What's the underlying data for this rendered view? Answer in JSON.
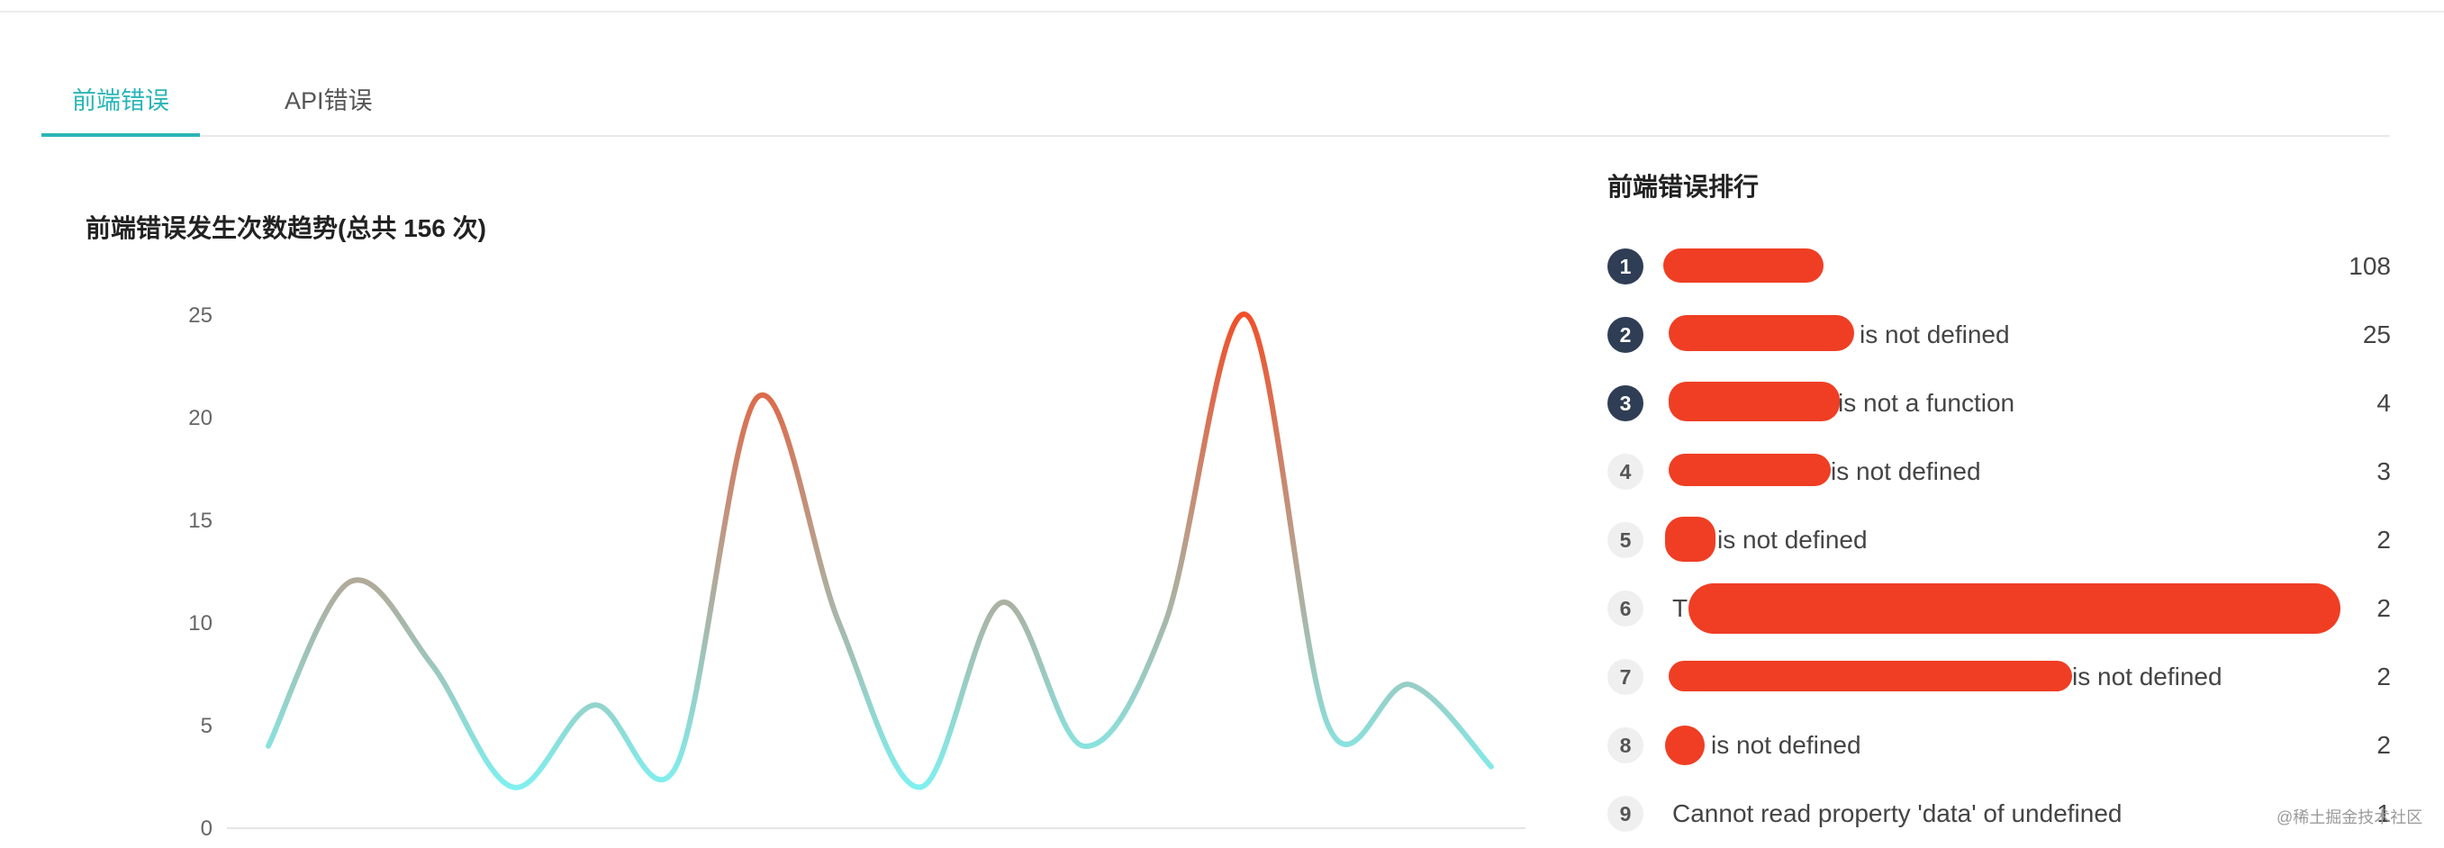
{
  "tabs": [
    {
      "label": "前端错误",
      "active": true
    },
    {
      "label": "API错误",
      "active": false
    }
  ],
  "chart_title": "前端错误发生次数趋势(总共 156 次)",
  "chart_data": {
    "type": "line",
    "title": "前端错误发生次数趋势(总共 156 次)",
    "yticks": [
      0,
      5,
      10,
      15,
      20,
      25
    ],
    "ylim": [
      0,
      25
    ],
    "values": [
      4,
      12,
      8,
      2,
      6,
      3,
      21,
      10,
      2,
      11,
      4,
      10,
      25,
      5,
      7,
      3
    ],
    "smooth": true,
    "gradient_colors": [
      "#7ff0f0",
      "#f0502a"
    ],
    "grid": false
  },
  "ranking": {
    "title": "前端错误排行",
    "items": [
      {
        "rank": "1",
        "text": "",
        "count": "108"
      },
      {
        "rank": "2",
        "text": "is not defined",
        "count": "25"
      },
      {
        "rank": "3",
        "text": "is not a function",
        "count": "4"
      },
      {
        "rank": "4",
        "text": "is not defined",
        "count": "3"
      },
      {
        "rank": "5",
        "text": "is not defined",
        "count": "2"
      },
      {
        "rank": "6",
        "text": "T",
        "count": "2"
      },
      {
        "rank": "7",
        "text": "is not defined",
        "count": "2"
      },
      {
        "rank": "8",
        "text": "is not defined",
        "count": "2"
      },
      {
        "rank": "9",
        "text": "Cannot read property 'data' of undefined",
        "count": "1"
      }
    ]
  },
  "watermark": "@稀土掘金技术社区",
  "colors": {
    "accent": "#2bb5b7",
    "badge_dark": "#2f3e55",
    "redaction": "#ef3e24"
  }
}
